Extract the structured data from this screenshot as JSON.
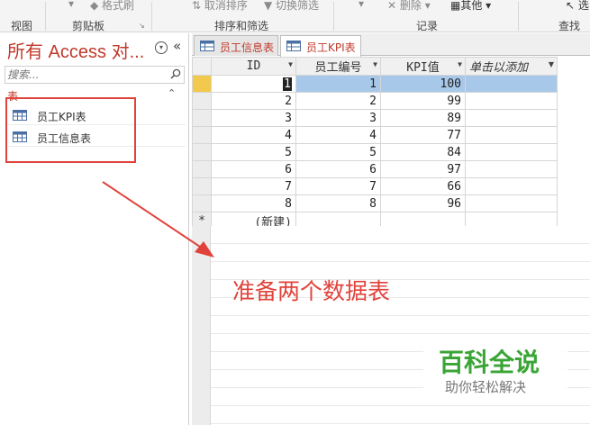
{
  "ribbon": {
    "items": [
      "格式刷",
      "取消排序",
      "切换筛选",
      "删除",
      "其他",
      "选"
    ],
    "groups": [
      "视图",
      "剪贴板",
      "排序和筛选",
      "记录",
      "查找"
    ]
  },
  "nav": {
    "title": "所有 Access 对...",
    "search_placeholder": "搜索...",
    "section_label": "表",
    "items": [
      {
        "label": "员工KPI表",
        "icon": "table-icon"
      },
      {
        "label": "员工信息表",
        "icon": "table-icon"
      }
    ]
  },
  "tabs": [
    {
      "label": "员工信息表",
      "active": false
    },
    {
      "label": "员工KPI表",
      "active": true
    }
  ],
  "grid": {
    "columns": [
      "ID",
      "员工编号",
      "KPI值",
      "单击以添加"
    ],
    "rows": [
      [
        "1",
        "1",
        "100"
      ],
      [
        "2",
        "2",
        "99"
      ],
      [
        "3",
        "3",
        "89"
      ],
      [
        "4",
        "4",
        "77"
      ],
      [
        "5",
        "5",
        "84"
      ],
      [
        "6",
        "6",
        "97"
      ],
      [
        "7",
        "7",
        "66"
      ],
      [
        "8",
        "8",
        "96"
      ]
    ],
    "new_row_marker": "*",
    "new_row_label": "(新建)"
  },
  "annotation": "准备两个数据表",
  "watermark": {
    "title": "百科全说",
    "subtitle": "助你轻松解决"
  },
  "colors": {
    "accent_red": "#e0433b",
    "selection_blue": "#a8c8ea",
    "record_selector_yellow": "#f2c94c",
    "watermark_green": "#3aa536"
  }
}
